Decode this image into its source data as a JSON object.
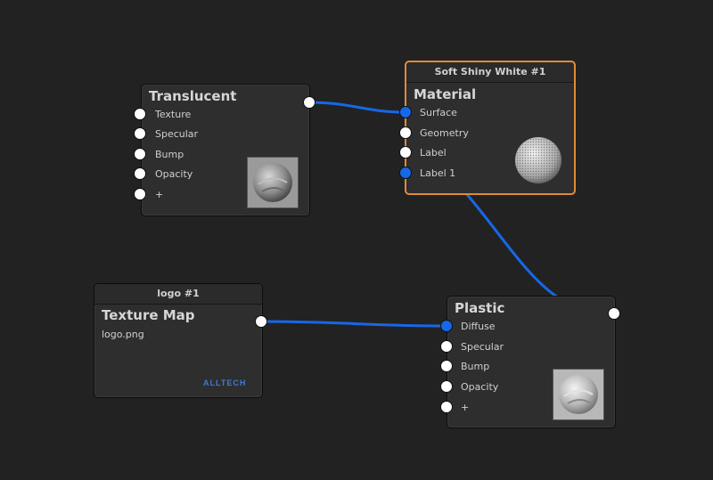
{
  "colors": {
    "background": "#222222",
    "node_bg": "#2e2e2e",
    "selected_outline": "#e08a3a",
    "wire": "#1668e6",
    "port_active": "#1668e6",
    "port_idle": "#ffffff"
  },
  "nodes": {
    "translucent": {
      "title": "Translucent",
      "inputs": [
        "Texture",
        "Specular",
        "Bump",
        "Opacity",
        "+"
      ],
      "thumbnail": "translucent-sphere-preview"
    },
    "material": {
      "header": "Soft Shiny White #1",
      "title": "Material",
      "inputs": [
        "Surface",
        "Geometry",
        "Label",
        "Label 1"
      ],
      "thumbnail": "dotted-sphere-preview",
      "selected": true
    },
    "texture_map": {
      "header": "logo #1",
      "title": "Texture Map",
      "filename": "logo.png",
      "logo_text": "ALLTECH"
    },
    "plastic": {
      "title": "Plastic",
      "inputs": [
        "Diffuse",
        "Specular",
        "Bump",
        "Opacity",
        "+"
      ],
      "thumbnail": "plastic-sphere-preview"
    }
  },
  "connections": [
    {
      "from": "Translucent.output",
      "to": "Material.Surface"
    },
    {
      "from": "Material.Label 1",
      "to": "Plastic.output"
    },
    {
      "from": "Texture Map.output",
      "to": "Plastic.Diffuse"
    }
  ]
}
